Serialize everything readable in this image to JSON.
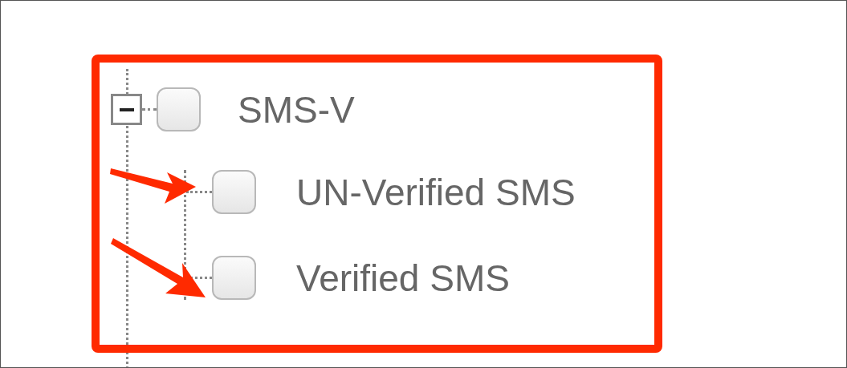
{
  "tree": {
    "items": [
      {
        "label": "SMS-V",
        "expanded": true,
        "checked": false,
        "children": [
          {
            "label": "UN-Verified SMS",
            "checked": false
          },
          {
            "label": "Verified SMS",
            "checked": false
          }
        ]
      }
    ]
  }
}
